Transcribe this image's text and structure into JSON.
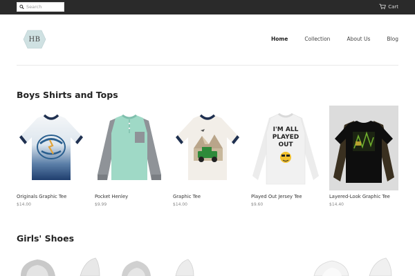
{
  "header": {
    "search_placeholder": "Search",
    "cart_label": "Cart"
  },
  "logo": {
    "text": "HB"
  },
  "nav": {
    "items": [
      {
        "label": "Home",
        "active": true
      },
      {
        "label": "Collection",
        "active": false
      },
      {
        "label": "About Us",
        "active": false
      },
      {
        "label": "Blog",
        "active": false
      }
    ]
  },
  "sections": [
    {
      "title": "Boys Shirts and Tops",
      "products": [
        {
          "name": "Originals Graphic Tee",
          "price": "$14.00"
        },
        {
          "name": "Pocket Henley",
          "price": "$9.99"
        },
        {
          "name": "Graphic Tee",
          "price": "$14.00"
        },
        {
          "name": "Played Out Jersey Tee",
          "price": "$9.60"
        },
        {
          "name": "Layered-Look Graphic Tee",
          "price": "$14.40"
        }
      ]
    },
    {
      "title": "Girls' Shoes"
    }
  ],
  "graphics": {
    "played_out_print": "I'M ALL PLAYED OUT"
  },
  "colors": {
    "topbar": "#2a2a2a",
    "logo_fill": "#cfe1e2",
    "navy": "#1f3050"
  }
}
